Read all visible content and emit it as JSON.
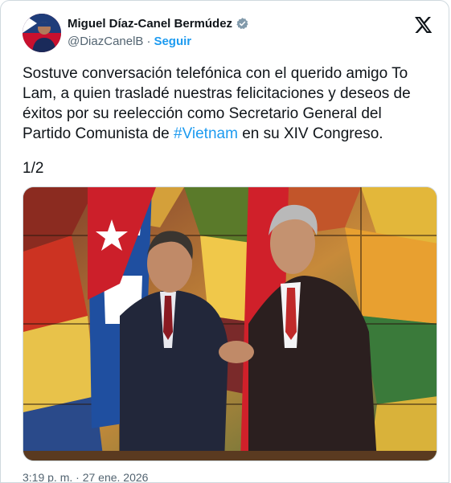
{
  "author": {
    "name": "Miguel Díaz-Canel Bermúdez",
    "handle": "@DiazCanelB",
    "separator": "·",
    "follow_label": "Seguir",
    "verified_icon": "verified-badge-icon",
    "avatar_icon": "profile-avatar"
  },
  "post": {
    "text_before": "Sostuve conversación telefónica con el querido amigo To Lam, a quien trasladé nuestras felicitaciones y deseos de éxitos por su reelección como Secretario General del Partido Comunista de ",
    "hashtag": "#Vietnam",
    "text_after": " en su XIV Congreso.",
    "thread_counter": "1/2",
    "timestamp": "3:19 p. m. · 27 ene. 2026"
  },
  "media": {
    "type": "photo",
    "description_icon": "handshake-photo"
  },
  "colors": {
    "accent": "#1d9bf0",
    "text": "#0f1419",
    "secondary": "#536471"
  }
}
